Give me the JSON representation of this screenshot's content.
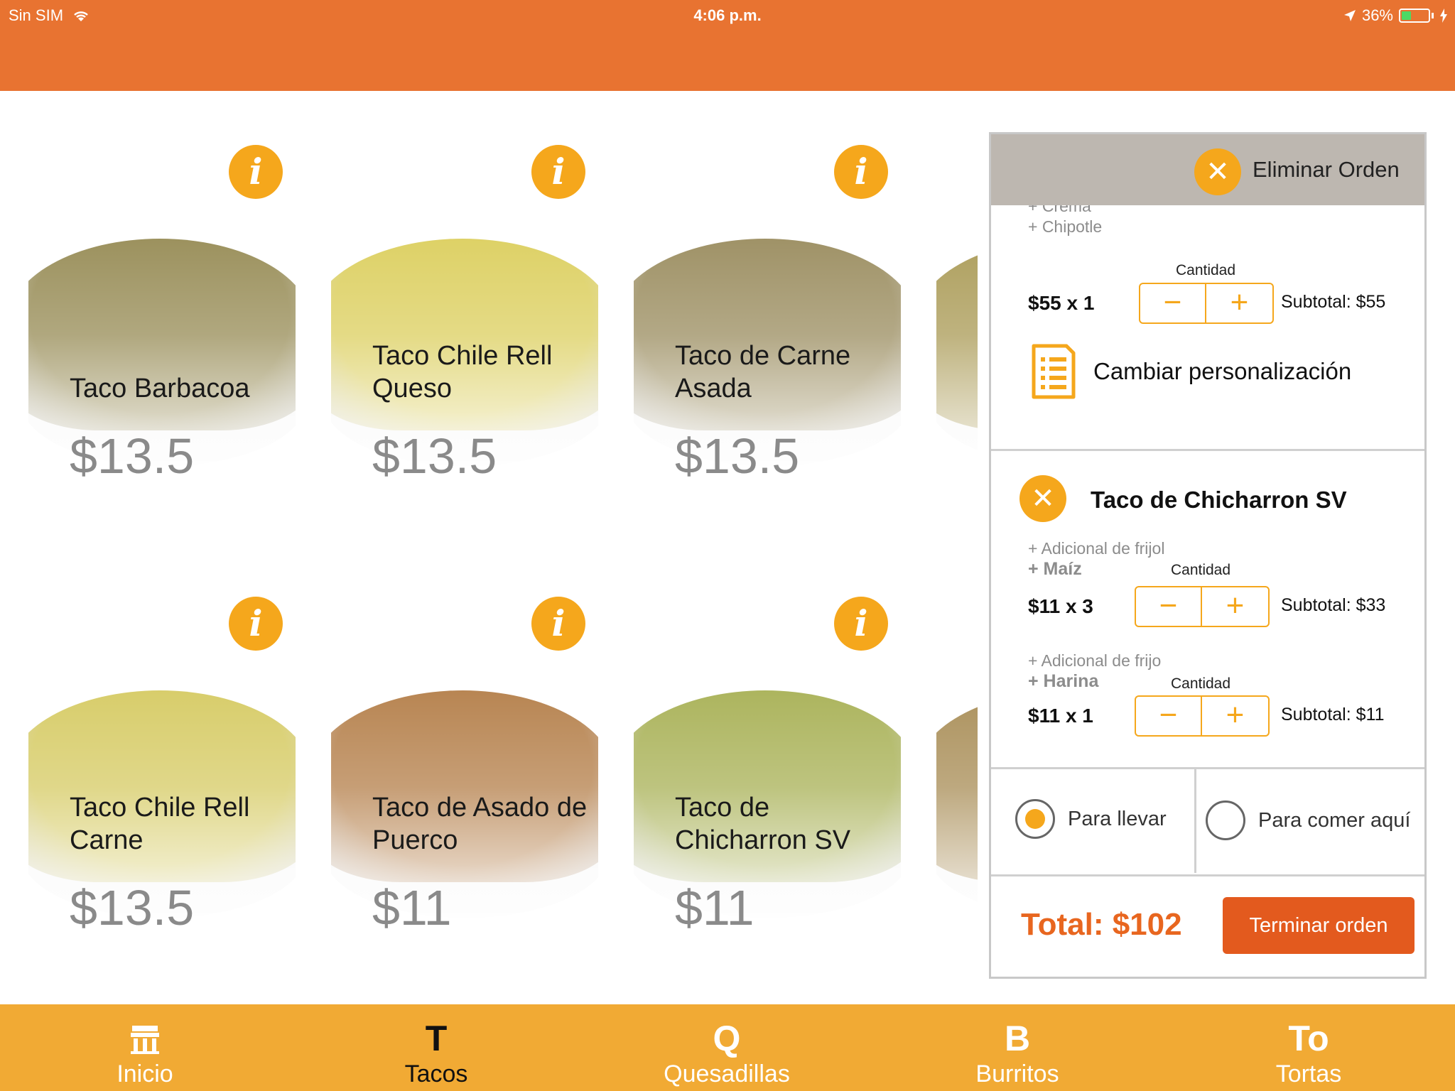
{
  "status_bar": {
    "carrier": "Sin SIM",
    "time": "4:06 p.m.",
    "battery": "36%",
    "battery_level": 0.36
  },
  "products": [
    {
      "name": "Taco Barbacoa",
      "price": "$13.5",
      "food_color": "#86793a"
    },
    {
      "name": "Taco Chile Rell Queso",
      "price": "$13.5",
      "food_color": "#d6c744"
    },
    {
      "name": "Taco de Carne Asada",
      "price": "$13.5",
      "food_color": "#8a7a45"
    },
    {
      "name": "Taco Chile Rell Carne",
      "price": "$13.5",
      "food_color": "#cfc24a"
    },
    {
      "name": "Taco de Asado de Puerco",
      "price": "$11",
      "food_color": "#a86a2c"
    },
    {
      "name": "Taco de Chicharron SV",
      "price": "$11",
      "food_color": "#9aa43a"
    }
  ],
  "cart": {
    "clear_label": "Eliminar Orden",
    "first_item": {
      "modifiers": [
        "+ Crema",
        "+ Chipotle"
      ],
      "qty_label": "Cantidad",
      "unit_line": "$55 x 1",
      "subtotal": "Subtotal: $55",
      "customize_label": "Cambiar personalización"
    },
    "second_item": {
      "title": "Taco de Chicharron SV",
      "variants": [
        {
          "extra": "+ Adicional de frijol",
          "base": "+ Maíz",
          "qty_label": "Cantidad",
          "unit_line": "$11 x 3",
          "subtotal": "Subtotal: $33"
        },
        {
          "extra": "+ Adicional de frijo",
          "base": "+ Harina",
          "qty_label": "Cantidad",
          "unit_line": "$11 x 1",
          "subtotal": "Subtotal: $11"
        }
      ]
    },
    "order_type": {
      "to_go": "Para llevar",
      "dine_in": "Para comer aquí",
      "selected": "to_go"
    },
    "total": "Total: $102",
    "finish_label": "Terminar orden"
  },
  "tabs": [
    {
      "icon": "T",
      "label": "Inicio"
    },
    {
      "icon": "T",
      "label": "Tacos",
      "active": true
    },
    {
      "icon": "Q",
      "label": "Quesadillas"
    },
    {
      "icon": "B",
      "label": "Burritos"
    },
    {
      "icon": "To",
      "label": "Tortas"
    }
  ],
  "colors": {
    "header": "#e87331",
    "accent": "#f5a71c",
    "tabbar": "#f1aa34",
    "total": "#e8661f",
    "finish_button": "#e35a1e"
  }
}
